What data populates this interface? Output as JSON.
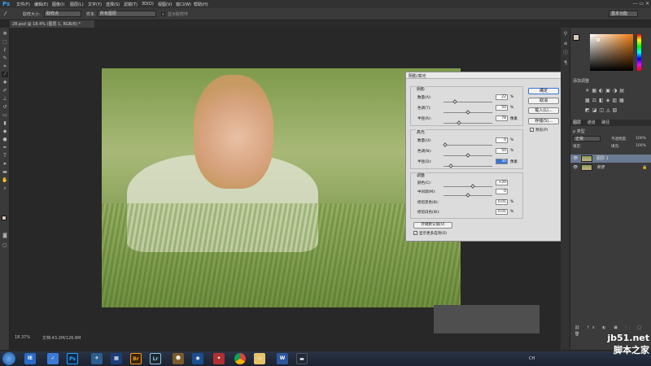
{
  "app": {
    "logo": "Ps"
  },
  "menu": [
    "文件(F)",
    "编辑(E)",
    "图像(I)",
    "图层(L)",
    "文字(Y)",
    "选择(S)",
    "滤镜(T)",
    "3D(D)",
    "视图(V)",
    "窗口(W)",
    "帮助(H)"
  ],
  "window_controls": "— ▭ ✕",
  "options": {
    "sample_size_label": "取样大小:",
    "sample_size_value": "取样点",
    "sample_label": "样本:",
    "sample_value": "所有图层",
    "show_ring_label": "显示取样环",
    "workspace": "基本功能"
  },
  "document": {
    "tab_title": "28.psd @ 18.4% (图层 1, RGB/8) *"
  },
  "status": {
    "zoom": "18.37%",
    "doc_size": "文档:43.2M/126.6M"
  },
  "dialog": {
    "title": "阴影/高光",
    "shadows": {
      "title": "阴影",
      "amount_label": "数量(A):",
      "amount": "22",
      "tone_label": "色调(T):",
      "tone": "50",
      "radius_label": "半径(R):",
      "radius": "78",
      "amount_level": 0.22,
      "tone_level": 0.5,
      "radius_level": 0.31
    },
    "highlights": {
      "title": "高光",
      "amount_label": "数量(U):",
      "amount": "0",
      "tone_label": "色调(N):",
      "tone": "50",
      "radius_label": "半径(D):",
      "radius": "30",
      "amount_level": 0.0,
      "tone_level": 0.5,
      "radius_level": 0.12
    },
    "adjust": {
      "title": "调整",
      "color_label": "颜色(C):",
      "color": "+20",
      "midtone_label": "中间调(M):",
      "midtone": "0",
      "clip_black_label": "修剪黑色(B):",
      "clip_black": "0.01",
      "clip_white_label": "修剪白色(W):",
      "clip_white": "0.01",
      "color_level": 0.6,
      "midtone_level": 0.5
    },
    "units": {
      "pct": "%",
      "px": "像素"
    },
    "save_default": "存储默认值(V)",
    "more_options": "显示更多选项(O)",
    "buttons": {
      "ok": "确定",
      "cancel": "取消",
      "load": "载入(L)...",
      "save": "存储(S)..."
    },
    "preview": "预览(P)"
  },
  "panels": {
    "adjust_title": "添加调整",
    "tabs": [
      "图层",
      "通道",
      "路径"
    ],
    "kind_label": "ρ 类型",
    "blend_mode": "正常",
    "opacity_label": "不透明度:",
    "opacity": "100%",
    "lock_label": "锁定:",
    "fill_label": "填充:",
    "fill": "100%",
    "layers": [
      {
        "name": "图层 1"
      },
      {
        "name": "背景"
      }
    ]
  },
  "taskbar": {
    "icons": [
      "IE",
      "Ps",
      "Br",
      "Lr",
      "W"
    ],
    "tray_text": "CH"
  },
  "watermark": {
    "line1": "jb51.net",
    "line2": "脚本之家"
  }
}
